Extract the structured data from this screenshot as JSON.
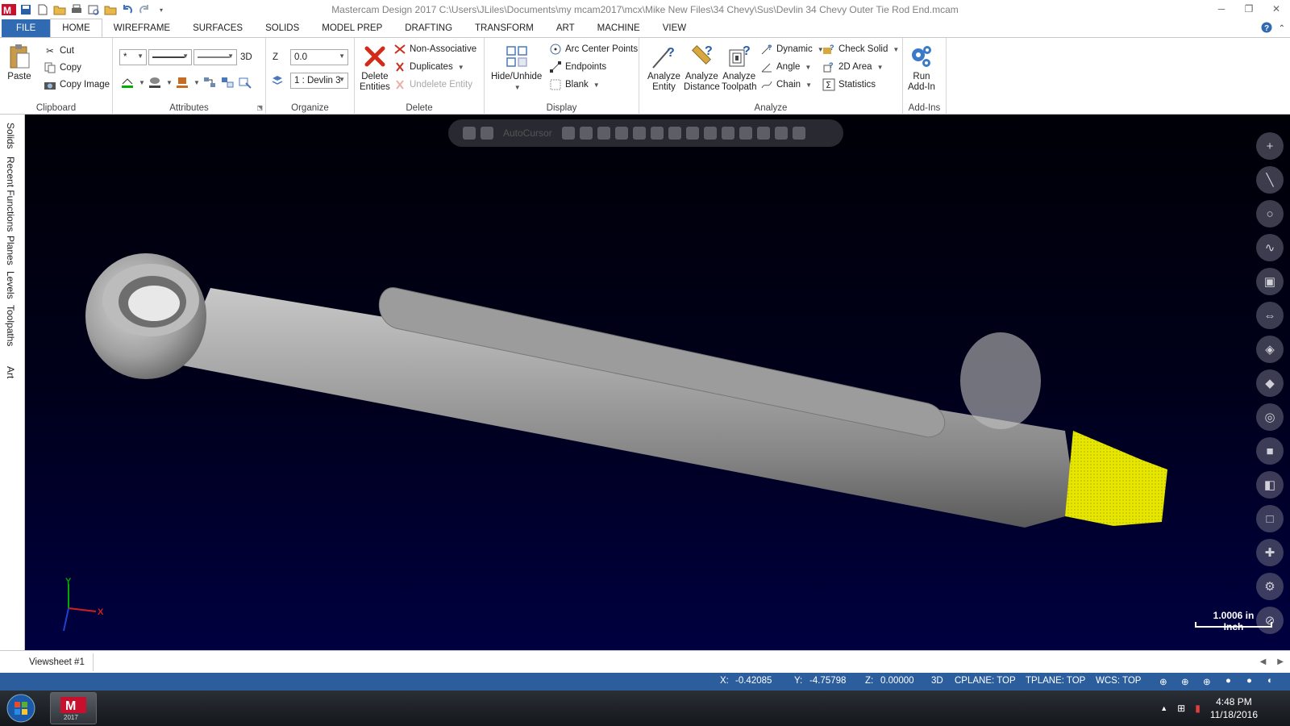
{
  "window": {
    "title": "Mastercam Design 2017  C:\\Users\\JLiles\\Documents\\my mcam2017\\mcx\\Mike New Files\\34 Chevy\\Sus\\Devlin 34 Chevy Outer Tie Rod End.mcam"
  },
  "tabs": {
    "file": "FILE",
    "home": "HOME",
    "wireframe": "WIREFRAME",
    "surfaces": "SURFACES",
    "solids": "SOLIDS",
    "model_prep": "MODEL PREP",
    "drafting": "DRAFTING",
    "transform": "TRANSFORM",
    "art": "ART",
    "machine": "MACHINE",
    "view": "VIEW"
  },
  "ribbon": {
    "clipboard": {
      "label": "Clipboard",
      "paste": "Paste",
      "cut": "Cut",
      "copy": "Copy",
      "copy_image": "Copy Image"
    },
    "attributes": {
      "label": "Attributes",
      "point_style": "*",
      "mode_3d": "3D"
    },
    "organize": {
      "label": "Organize",
      "z_label": "Z",
      "z_value": "0.0",
      "level_value": "1 : Devlin 3"
    },
    "delete": {
      "label": "Delete",
      "delete_entities": "Delete\nEntities",
      "non_associative": "Non-Associative",
      "duplicates": "Duplicates",
      "undelete": "Undelete Entity"
    },
    "display": {
      "label": "Display",
      "hide_unhide": "Hide/Unhide",
      "arc_center": "Arc Center Points",
      "endpoints": "Endpoints",
      "blank": "Blank"
    },
    "analyze": {
      "label": "Analyze",
      "analyze_entity": "Analyze\nEntity",
      "analyze_distance": "Analyze\nDistance",
      "analyze_toolpath": "Analyze\nToolpath",
      "dynamic": "Dynamic",
      "angle": "Angle",
      "chain": "Chain",
      "check_solid": "Check Solid",
      "area_2d": "2D Area",
      "statistics": "Statistics"
    },
    "addins": {
      "label": "Add-Ins",
      "run_addin": "Run\nAdd-In"
    }
  },
  "left_tabs": [
    "Solids",
    "Recent Functions",
    "Planes",
    "Levels",
    "Toolpaths",
    "Art"
  ],
  "viewport": {
    "autocursor": "AutoCursor",
    "scale_value": "1.0006 in",
    "scale_unit": "Inch",
    "axis_x": "X",
    "axis_y": "Y"
  },
  "viewsheet": {
    "tab": "Viewsheet #1"
  },
  "status": {
    "x_label": "X:",
    "x_value": "-0.42085",
    "y_label": "Y:",
    "y_value": "-4.75798",
    "z_label": "Z:",
    "z_value": "0.00000",
    "mode": "3D",
    "cplane": "CPLANE: TOP",
    "tplane": "TPLANE: TOP",
    "wcs": "WCS: TOP"
  },
  "taskbar": {
    "time": "4:48 PM",
    "date": "11/18/2016",
    "app_label": "2017"
  },
  "colors": {
    "accent": "#2c5e9e",
    "file_tab": "#2f6ab2",
    "highlight": "#e0e000"
  }
}
